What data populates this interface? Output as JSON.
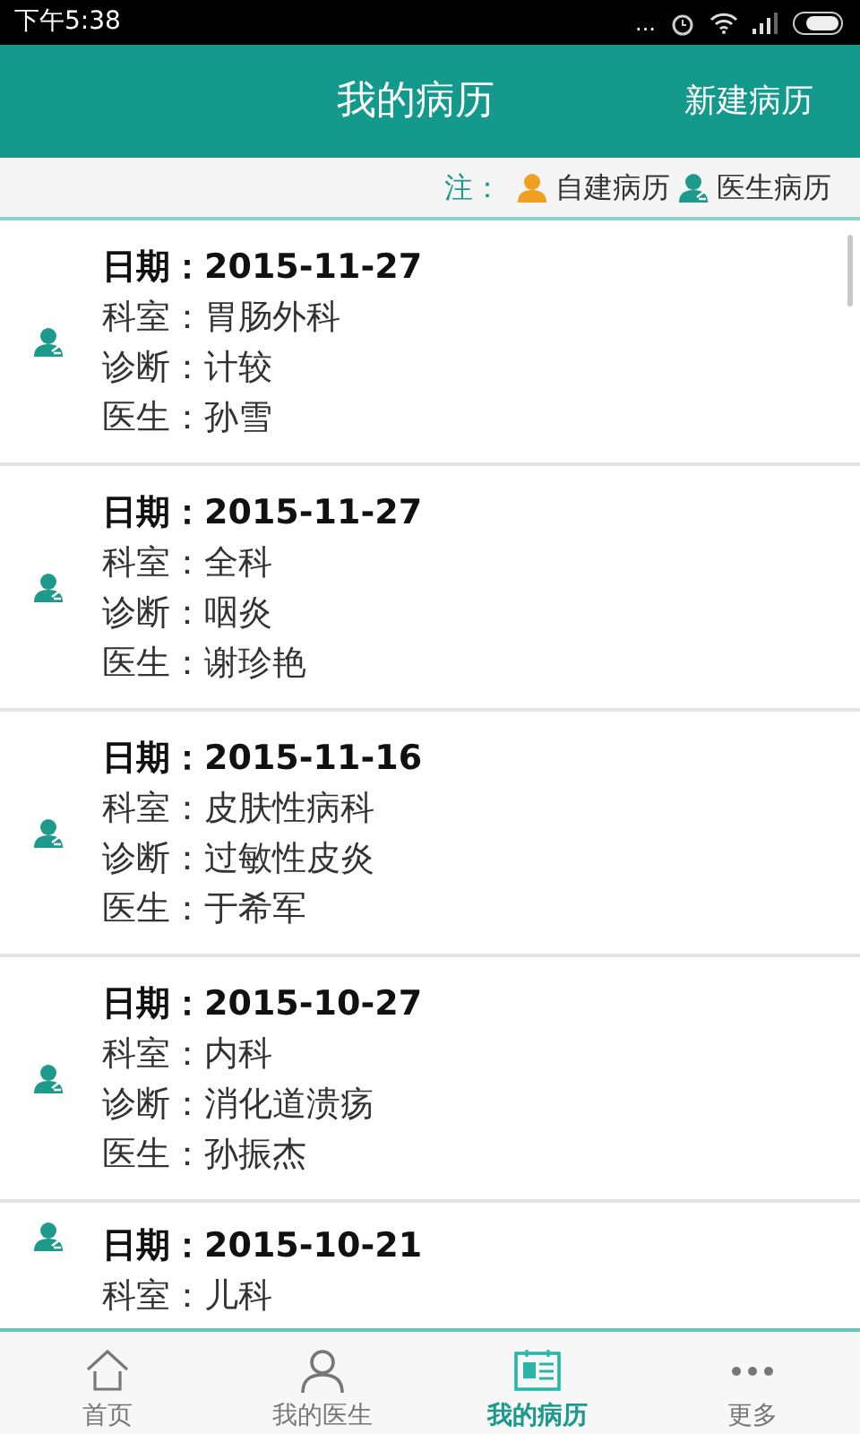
{
  "status_bar": {
    "time": "下午5:38",
    "dots": "..."
  },
  "header": {
    "title": "我的病历",
    "action": "新建病历"
  },
  "legend": {
    "label": "注：",
    "items": [
      {
        "kind": "self",
        "text": "自建病历"
      },
      {
        "kind": "doctor",
        "text": "医生病历"
      }
    ]
  },
  "records": [
    {
      "kind": "doctor",
      "lines": [
        "日期：2015-11-27",
        "科室：胃肠外科",
        "诊断：计较",
        "医生：孙雪"
      ]
    },
    {
      "kind": "doctor",
      "lines": [
        "日期：2015-11-27",
        "科室：全科",
        "诊断：咽炎",
        "医生：谢珍艳"
      ]
    },
    {
      "kind": "doctor",
      "lines": [
        "日期：2015-11-16",
        "科室：皮肤性病科",
        "诊断：过敏性皮炎",
        "医生：于希军"
      ]
    },
    {
      "kind": "doctor",
      "lines": [
        "日期：2015-10-27",
        "科室：内科",
        "诊断：消化道溃疡",
        "医生：孙振杰"
      ]
    },
    {
      "kind": "doctor",
      "lines": [
        "日期：2015-10-21",
        "科室：儿科"
      ]
    }
  ],
  "tabs": [
    {
      "kind": "home",
      "label": "首页",
      "selected": false
    },
    {
      "kind": "person",
      "label": "我的医生",
      "selected": false
    },
    {
      "kind": "card",
      "label": "我的病历",
      "selected": true
    },
    {
      "kind": "more",
      "label": "更多",
      "selected": false
    }
  ]
}
